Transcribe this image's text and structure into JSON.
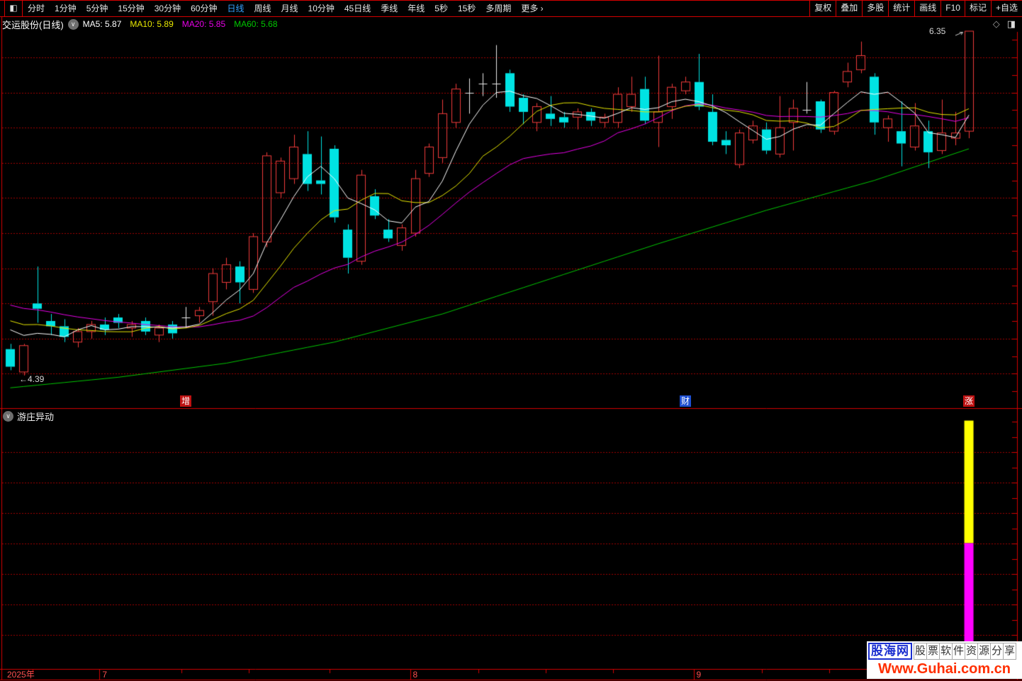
{
  "toolbar": {
    "periods": [
      "分时",
      "1分钟",
      "5分钟",
      "15分钟",
      "30分钟",
      "60分钟",
      "日线",
      "周线",
      "月线",
      "10分钟",
      "45日线",
      "季线",
      "年线",
      "5秒",
      "15秒",
      "多周期",
      "更多 ›"
    ],
    "active_period": "日线",
    "right_buttons": [
      "复权",
      "叠加",
      "多股",
      "统计",
      "画线",
      "F10",
      "标记",
      "+自选"
    ]
  },
  "title_row": {
    "stock_title": "交运股份(日线)",
    "ma_labels": [
      {
        "text": "MA5: 5.87",
        "color": "#ffffff"
      },
      {
        "text": "MA10: 5.89",
        "color": "#e8e800"
      },
      {
        "text": "MA20: 5.85",
        "color": "#e800e8"
      },
      {
        "text": "MA60: 5.68",
        "color": "#00c800"
      }
    ]
  },
  "icons": {
    "diamond": "◇",
    "panel_right": "◨",
    "panel_left": "◧",
    "chevron_down": "∨"
  },
  "annotations": {
    "high_label": "6.35",
    "low_label": "←4.39"
  },
  "markers": [
    {
      "text": "增",
      "bg": "#be1212",
      "index": 13
    },
    {
      "text": "财",
      "bg": "#1e4fd2",
      "index": 50
    },
    {
      "text": "涨",
      "bg": "#be1212",
      "index": 71
    }
  ],
  "indicator": {
    "name": "游庄异动"
  },
  "date_axis": {
    "labels": [
      {
        "text": "2025年",
        "index": 0,
        "separator": false
      },
      {
        "text": "7",
        "index": 7,
        "separator": true
      },
      {
        "text": "8",
        "index": 30,
        "separator": true
      },
      {
        "text": "9",
        "index": 51,
        "separator": true
      }
    ],
    "week_tick_indices": [
      2,
      13,
      18,
      24,
      35,
      40,
      45,
      56,
      61,
      66
    ]
  },
  "watermark": {
    "brand": "股海网",
    "tagline": "股票软件资源分享",
    "url": "Www.Guhai.com.cn"
  },
  "colors": {
    "up": "#f13b3b",
    "down": "#00e3e3",
    "flat": "#e8e8e8",
    "grid": "#a00000",
    "frame": "#d40000",
    "axis_text": "#ff5050",
    "signal_yellow": "#ffff00",
    "signal_magenta": "#ff00ff"
  },
  "chart_data": [
    {
      "type": "candlestick",
      "title": "交运股份 日线",
      "y_grid": {
        "min": 4.4,
        "max": 6.2,
        "step": 0.2
      },
      "high_annotation": 6.35,
      "low_annotation": 4.39,
      "ma_colors": {
        "MA5": "#ffffff",
        "MA10": "#e8e800",
        "MA20": "#e800e8",
        "MA60": "#00c800"
      },
      "prehistory_closes": [
        4.95,
        4.94,
        4.93,
        4.92,
        4.91,
        4.9,
        4.88,
        4.86,
        4.84,
        4.82,
        4.8,
        4.78,
        4.76,
        4.75,
        4.74,
        4.73,
        4.72,
        4.71,
        4.7,
        4.68
      ],
      "ma60_points": [
        [
          0,
          4.32
        ],
        [
          8,
          4.38
        ],
        [
          16,
          4.46
        ],
        [
          24,
          4.58
        ],
        [
          32,
          4.74
        ],
        [
          40,
          4.94
        ],
        [
          48,
          5.14
        ],
        [
          56,
          5.33
        ],
        [
          64,
          5.5
        ],
        [
          71,
          5.68
        ]
      ],
      "candles": [
        [
          4.54,
          4.57,
          4.42,
          4.44
        ],
        [
          4.41,
          4.57,
          4.39,
          4.56
        ],
        [
          4.8,
          5.01,
          4.69,
          4.77
        ],
        [
          4.7,
          4.74,
          4.62,
          4.67
        ],
        [
          4.67,
          4.71,
          4.58,
          4.61
        ],
        [
          4.58,
          4.66,
          4.55,
          4.64
        ],
        [
          4.64,
          4.7,
          4.6,
          4.68
        ],
        [
          4.68,
          4.72,
          4.62,
          4.65
        ],
        [
          4.72,
          4.74,
          4.66,
          4.69
        ],
        [
          4.66,
          4.7,
          4.61,
          4.68
        ],
        [
          4.7,
          4.72,
          4.62,
          4.64
        ],
        [
          4.62,
          4.68,
          4.58,
          4.66
        ],
        [
          4.68,
          4.7,
          4.6,
          4.63
        ],
        [
          4.72,
          4.78,
          4.66,
          4.72
        ],
        [
          4.73,
          4.78,
          4.69,
          4.76
        ],
        [
          4.81,
          5.0,
          4.73,
          4.97
        ],
        [
          4.92,
          5.06,
          4.88,
          5.02
        ],
        [
          5.01,
          5.04,
          4.8,
          4.92
        ],
        [
          4.88,
          5.2,
          4.86,
          5.18
        ],
        [
          5.15,
          5.66,
          5.12,
          5.64
        ],
        [
          5.43,
          5.63,
          5.4,
          5.61
        ],
        [
          5.51,
          5.76,
          5.48,
          5.69
        ],
        [
          5.65,
          5.78,
          5.44,
          5.48
        ],
        [
          5.5,
          5.75,
          5.42,
          5.48
        ],
        [
          5.68,
          5.7,
          5.26,
          5.29
        ],
        [
          5.22,
          5.25,
          4.97,
          5.06
        ],
        [
          5.04,
          5.56,
          5.02,
          5.53
        ],
        [
          5.41,
          5.45,
          5.28,
          5.3
        ],
        [
          5.22,
          5.28,
          5.15,
          5.17
        ],
        [
          5.13,
          5.25,
          5.1,
          5.23
        ],
        [
          5.2,
          5.56,
          5.18,
          5.51
        ],
        [
          5.54,
          5.71,
          5.52,
          5.69
        ],
        [
          5.63,
          5.96,
          5.6,
          5.88
        ],
        [
          5.83,
          6.05,
          5.8,
          6.02
        ],
        [
          6.0,
          6.08,
          5.88,
          6.0
        ],
        [
          6.05,
          6.11,
          5.98,
          6.05
        ],
        [
          6.05,
          6.27,
          5.97,
          6.05
        ],
        [
          6.11,
          6.13,
          5.89,
          5.92
        ],
        [
          5.97,
          5.99,
          5.82,
          5.89
        ],
        [
          5.83,
          5.94,
          5.78,
          5.92
        ],
        [
          5.88,
          5.98,
          5.81,
          5.85
        ],
        [
          5.86,
          5.89,
          5.8,
          5.83
        ],
        [
          5.86,
          5.91,
          5.79,
          5.89
        ],
        [
          5.89,
          5.91,
          5.81,
          5.84
        ],
        [
          5.83,
          5.88,
          5.8,
          5.86
        ],
        [
          5.83,
          6.03,
          5.8,
          5.99
        ],
        [
          5.92,
          6.09,
          5.89,
          5.99
        ],
        [
          6.02,
          6.09,
          5.82,
          5.84
        ],
        [
          5.83,
          6.21,
          5.69,
          5.89
        ],
        [
          5.92,
          6.05,
          5.85,
          6.03
        ],
        [
          6.01,
          6.09,
          5.99,
          6.06
        ],
        [
          6.06,
          6.22,
          5.9,
          5.92
        ],
        [
          5.89,
          5.99,
          5.7,
          5.72
        ],
        [
          5.73,
          5.78,
          5.65,
          5.7
        ],
        [
          5.59,
          5.79,
          5.57,
          5.77
        ],
        [
          5.73,
          5.84,
          5.71,
          5.81
        ],
        [
          5.79,
          5.83,
          5.65,
          5.67
        ],
        [
          5.65,
          5.98,
          5.63,
          5.8
        ],
        [
          5.83,
          5.96,
          5.67,
          5.91
        ],
        [
          5.9,
          6.06,
          5.88,
          5.9
        ],
        [
          5.95,
          5.96,
          5.77,
          5.79
        ],
        [
          5.78,
          6.01,
          5.76,
          6.0
        ],
        [
          6.06,
          6.17,
          6.03,
          6.12
        ],
        [
          6.13,
          6.29,
          6.11,
          6.21
        ],
        [
          6.09,
          6.11,
          5.76,
          5.83
        ],
        [
          5.8,
          5.87,
          5.72,
          5.85
        ],
        [
          5.78,
          5.95,
          5.58,
          5.71
        ],
        [
          5.69,
          5.94,
          5.67,
          5.81
        ],
        [
          5.78,
          5.84,
          5.57,
          5.66
        ],
        [
          5.67,
          5.96,
          5.65,
          5.77
        ],
        [
          5.74,
          5.89,
          5.7,
          5.77
        ],
        [
          5.78,
          6.35,
          5.74,
          6.35
        ]
      ]
    },
    {
      "type": "bar",
      "name": "游庄异动",
      "bars": [
        {
          "index": 71,
          "segments": [
            {
              "color": "#ffff00",
              "from": 0.5,
              "to": 0.99
            },
            {
              "color": "#ff00ff",
              "from": 0.0,
              "to": 0.5
            }
          ]
        }
      ]
    }
  ]
}
